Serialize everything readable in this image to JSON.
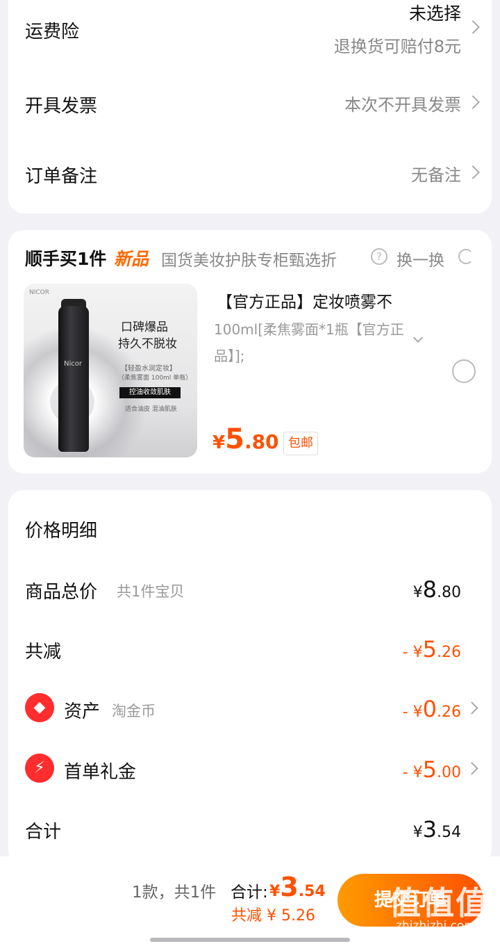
{
  "shipping_insurance": {
    "label": "运费险",
    "value": "未选择",
    "note": "退换货可赔付8元"
  },
  "invoice": {
    "label": "开具发票",
    "value": "本次不开具发票"
  },
  "remark": {
    "label": "订单备注",
    "value": "无备注"
  },
  "add_on": {
    "title": "顺手买1件",
    "new_tag": "新品",
    "subtitle": "国货美妆护肤专柜甄选折",
    "help_icon": "question-circle-icon",
    "help_glyph": "?",
    "swap_label": "换一换",
    "refresh_icon": "refresh-icon",
    "product": {
      "image": {
        "brand": "NICOR",
        "bottle_brand": "Nicor",
        "headline1": "口碑爆品",
        "headline2": "持久不脱妆",
        "sub1": "【轻盈水润定妆】",
        "sub2": "（柔焦雾面 100ml 单瓶）",
        "tag": "控油收敛肌肤",
        "sub3": "适合油皮 混油肌肤"
      },
      "title": "【官方正品】定妆喷雾不",
      "spec": "100ml[柔焦雾面*1瓶【官方正品】];",
      "price_currency": "¥",
      "price_int": "5",
      "price_dec": ".80",
      "shipping_tag": "包邮"
    }
  },
  "price_detail": {
    "title": "价格明细",
    "goods_total": {
      "label": "商品总价",
      "sub": "共1件宝贝",
      "currency": "¥",
      "int": "8",
      "dec": ".80"
    },
    "discount": {
      "label": "共减",
      "prefix": "- ",
      "currency": "¥",
      "int": "5",
      "dec": ".26"
    },
    "assets": {
      "icon": "coupon-tag-icon",
      "icon_glyph": "◆",
      "label": "资产",
      "sub": "淘金币",
      "prefix": "- ",
      "currency": "¥",
      "int": "0",
      "dec": ".26"
    },
    "first_order": {
      "icon": "lightning-icon",
      "icon_glyph": "⚡",
      "label": "首单礼金",
      "prefix": "- ",
      "currency": "¥",
      "int": "5",
      "dec": ".00"
    },
    "total": {
      "label": "合计",
      "currency": "¥",
      "int": "3",
      "dec": ".54"
    }
  },
  "bottom_bar": {
    "count": "1款，共1件",
    "total_label": "合计:",
    "total_currency": "¥",
    "total_int": "3",
    "total_dec": ".54",
    "saved": "共减 ¥ 5.26",
    "submit_label": "提交订单",
    "watermark": "值值值",
    "watermark_sub": "zhizhizhi.com"
  },
  "colors": {
    "accent": "#ff5000",
    "accent_start": "#ff9a00",
    "background": "#f2f2f6"
  }
}
